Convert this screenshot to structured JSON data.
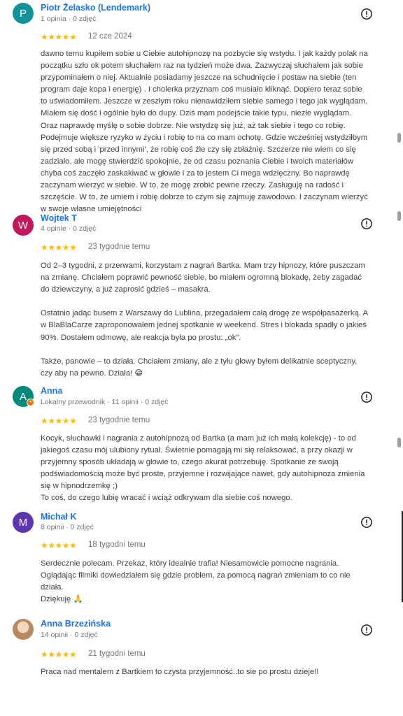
{
  "reviews": [
    {
      "name": "Piotr Żelasko (Lendemark)",
      "meta": "1 opinia · 0 zdjęć",
      "initial": "P",
      "avatar_color": "#12939a",
      "stars": "★★★★★",
      "date": "12 cze 2024",
      "text": "dawno temu kupiłem sobie u Ciebie autohipnozę na pozbycie się wstydu. I jak każdy polak na początku szło ok potem słuchałem raz na tydzień może dwa. Zazwyczaj słuchałem jak sobie przypominałem o niej. Aktualnie posiadamy jeszcze na schudnięcie i postaw na siebie (ten program daje kopa i energię) . I cholerka przyznam coś musiało kliknąć. Dopiero teraz sobie to uświadomiłem. Jeszcze w zeszłym roku nienawidziłem siebie samego i tego jak wyglądam. Miałem się dość i ogólnie było do dupy. Dziś mam podejście takie typu, niezłe wyglądam. Oraz naprawdę myślę o sobie dobrze. Nie wstydzę się już, aż tak siebie i tego co robię. Podejmuje większe ryzyko w życiu i robię to na co mam ochotę. Gdzie wcześniej wstydziłbym się przed sobą i 'przed innymi', że robię coś źle czy się zbłaźnię. Szczerze nie wiem co się zadziało, ale mogę stwierdzić spokojnie, że od czasu poznania Ciebie i twoich materiałów chyba coś zaczęło zaskakiwać w głowie i za to jestem Ci mega wdzięczny. Bo naprawdę zaczynam wierzyć w siebie. W to, że mogę zrobić pewne rzeczy. Zasługuję na radość i szczęście. W to, że umiem i robię dobrze to czym się zajmuję zawodowo. I zaczynam wierzyć w swoje własne umiejętności"
    },
    {
      "name": "Wojtek T",
      "meta": "4 opinie · 0 zdjęć",
      "initial": "W",
      "avatar_color": "#c2185b",
      "stars": "★★★★★",
      "date": "23 tygodnie temu",
      "text": "Od 2–3 tygodni, z przerwami, korzystam z nagrań Bartka. Mam trzy hipnozy, które puszczam na zmianę. Chciałem poprawić pewność siebie, bo miałem ogromną blokadę, żeby zagadać do dziewczyny, a już zaprosić gdzieś – masakra.\n\nOstatnio jadąc busem z Warszawy do Lublina, przegadałem całą drogę ze współpasażerką. A w BlaBlaCarze zaproponowałem jednej spotkanie w weekend. Stres i blokada spadły o jakieś 90%. Dostałem odmowę, ale reakcja była po prostu: „ok”.\n\nTakże, panowie – to działa. Chciałem zmiany, ale z tyłu głowy byłem delikatnie sceptyczny, czy aby na pewno. Działa! 😁"
    },
    {
      "name": "Anna",
      "meta": "Lokalny przewodnik · 11 opinii · 0 zdjęć",
      "initial": "A",
      "avatar_color": "#00897b",
      "stars": "★★★★★",
      "date": "23 tygodnie temu",
      "text": "Kocyk, słuchawki i nagrania z autohipnozą od Bartka (a mam już ich małą kolekcję) - to od jakiegoś czasu mój ulubiony rytuał. Świetnie pomagają mi się relaksować, a przy okazji w przyjemny sposób układają w głowie to, czego akurat potrzebuję. Spotkanie ze swoją podświadomością może być proste, przyjemne i rozwijające nawet, gdy autohipnoza zmienia się w hipnodrzemkę ;)\nTo coś, do czego lubię wracać i wciąż odkrywam dla siebie coś nowego."
    },
    {
      "name": "Michał K",
      "meta": "8 opinii · 0 zdjęć",
      "initial": "M",
      "avatar_color": "#5e35b1",
      "stars": "★★★★★",
      "date": "18 tygodni temu",
      "text": "Serdecznie polecam. Przekaz, który idealnie trafia! Niesamowicie pomocne nagrania. Oglądając filmiki dowiedziałem się gdzie problem, za pomocą nagrań zmieniam to co nie działa.\nDziękuję 🙏"
    },
    {
      "name": "Anna Brzezińska",
      "meta": "14 opinii · 0 zdjęć",
      "initial": "",
      "avatar_color": "#c9a98c",
      "stars": "★★★★★",
      "date": "21 tygodni temu",
      "text": "Praca nad mentalem z Bartkiem to czysta przyjemność..to sie po prostu dzieje!!"
    }
  ],
  "icons": {
    "report": "report-icon",
    "guide_badge": "local-guide-badge-icon"
  }
}
